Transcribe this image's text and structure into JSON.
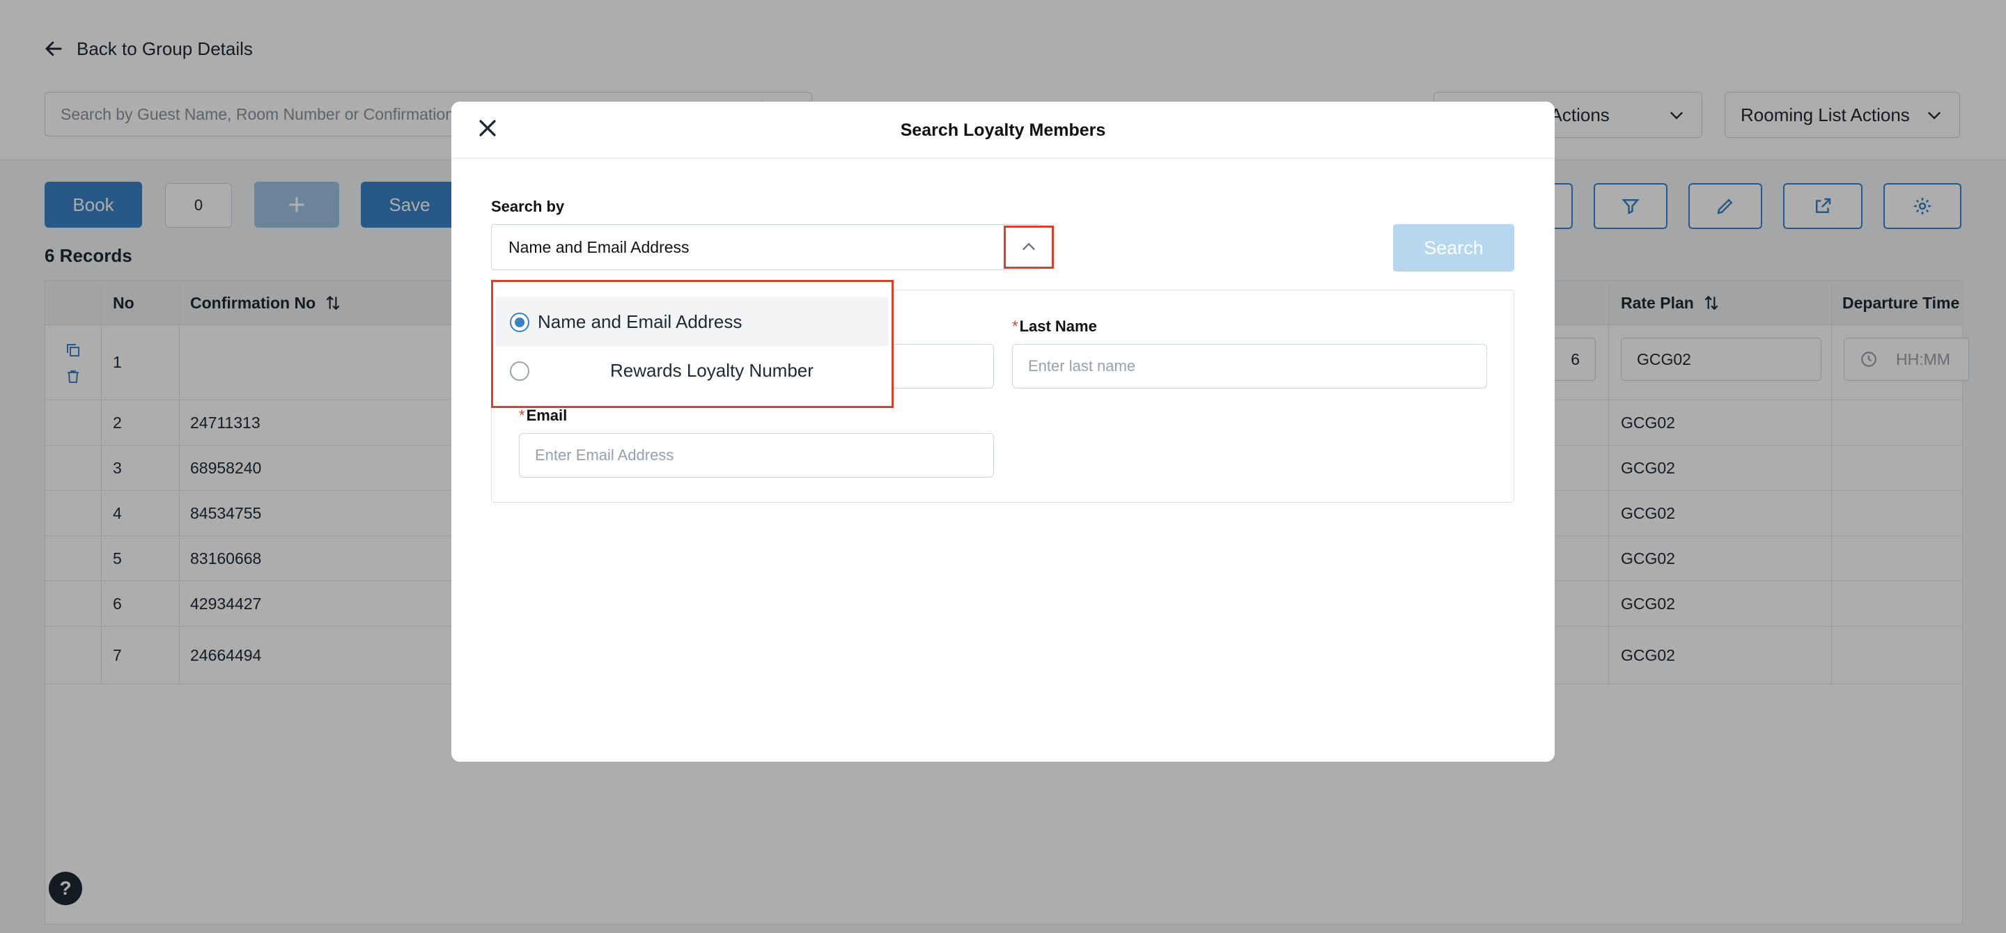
{
  "page": {
    "back_label": "Back to Group Details",
    "search_placeholder": "Search by Guest Name, Room Number or Confirmation Number",
    "reservation_actions_label": "Reservation Actions",
    "rooming_list_actions_label": "Rooming List Actions",
    "book_label": "Book",
    "count_value": "0",
    "save_label": "Save",
    "records_label": "6 Records",
    "help_label": "?"
  },
  "table": {
    "headers": {
      "no": "No",
      "confirmation": "Confirmation No",
      "rate_plan": "Rate Plan",
      "departure_time": "Departure Time"
    },
    "rows": [
      {
        "no": "1",
        "confirmation": "",
        "rate_plan": "GCG02",
        "partial": "6",
        "time_placeholder": "HH:MM"
      },
      {
        "no": "2",
        "confirmation": "24711313",
        "rate_plan": "GCG02"
      },
      {
        "no": "3",
        "confirmation": "68958240",
        "rate_plan": "GCG02"
      },
      {
        "no": "4",
        "confirmation": "84534755",
        "rate_plan": "GCG02"
      },
      {
        "no": "5",
        "confirmation": "83160668",
        "rate_plan": "GCG02"
      },
      {
        "no": "6",
        "confirmation": "42934427",
        "rate_plan": "GCG02"
      },
      {
        "no": "7",
        "confirmation": "24664494",
        "rate_plan": "GCG02"
      }
    ]
  },
  "modal": {
    "title": "Search Loyalty Members",
    "search_by_label": "Search by",
    "selected_option": "Name and Email Address",
    "search_button": "Search",
    "options": [
      {
        "label": "Name and Email Address",
        "selected": true
      },
      {
        "label": "Rewards Loyalty Number",
        "selected": false
      }
    ],
    "fields": {
      "last_name_label": "Last Name",
      "last_name_placeholder": "Enter last name",
      "email_label": "Email",
      "email_placeholder": "Enter Email Address",
      "required_mark": "*"
    }
  },
  "colors": {
    "primary": "#3b82c4",
    "highlight": "#d9402e",
    "overlay": "rgba(0,0,0,0.32)"
  }
}
